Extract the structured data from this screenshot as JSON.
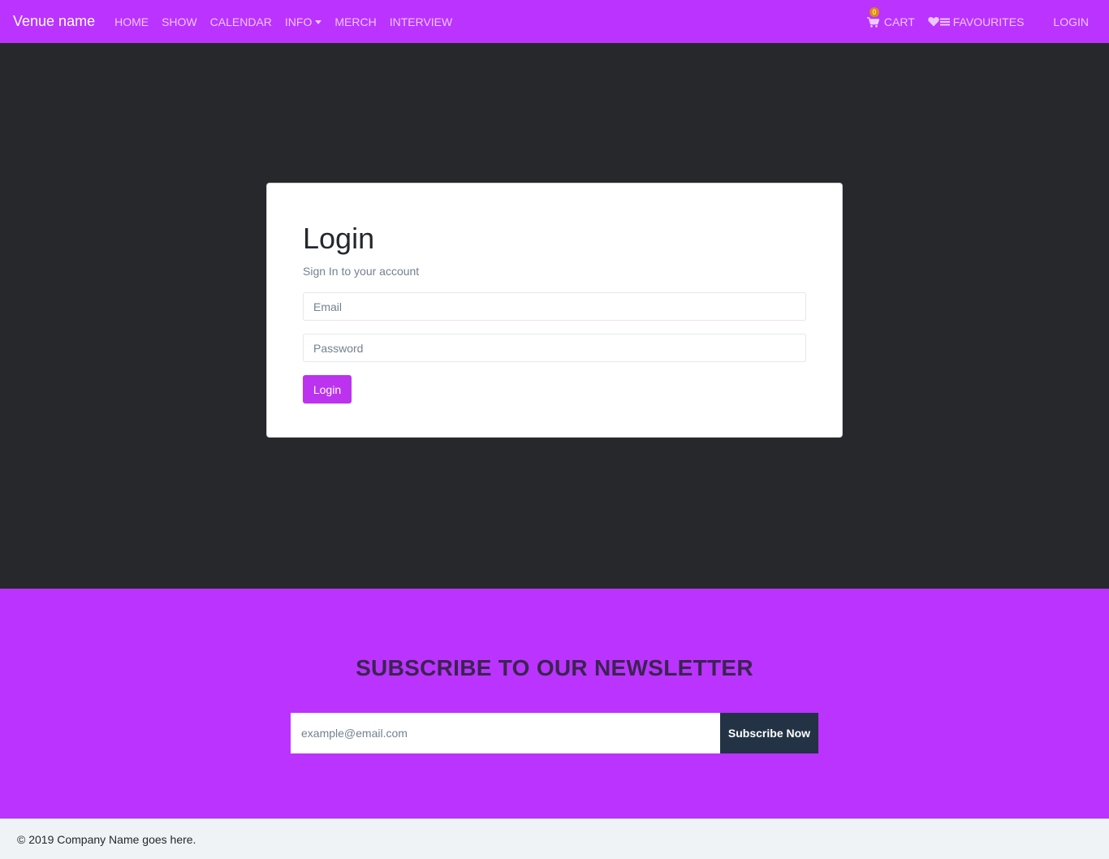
{
  "navbar": {
    "brand": "Venue name",
    "links": [
      {
        "label": "HOME"
      },
      {
        "label": "SHOW"
      },
      {
        "label": "CALENDAR"
      },
      {
        "label": "INFO",
        "dropdown": true
      },
      {
        "label": "MERCH"
      },
      {
        "label": "INTERVIEW"
      }
    ],
    "cart": {
      "label": "CART",
      "count": "0",
      "icon": "cart-icon"
    },
    "favourites": {
      "label": "FAVOURITES",
      "icon": "heart-list-icon"
    },
    "login": {
      "label": "LOGIN"
    }
  },
  "login_card": {
    "title": "Login",
    "subtitle": "Sign In to your account",
    "email_placeholder": "Email",
    "password_placeholder": "Password",
    "submit_label": "Login"
  },
  "newsletter": {
    "title": "SUBSCRIBE TO OUR NEWSLETTER",
    "input_placeholder": "example@email.com",
    "button_label": "Subscribe Now"
  },
  "footer": {
    "copyright": "© 2019 Company Name goes here."
  },
  "colors": {
    "brand_purple": "#bb33ff",
    "dark_bg": "#27282b",
    "subscribe_button": "#233345"
  }
}
